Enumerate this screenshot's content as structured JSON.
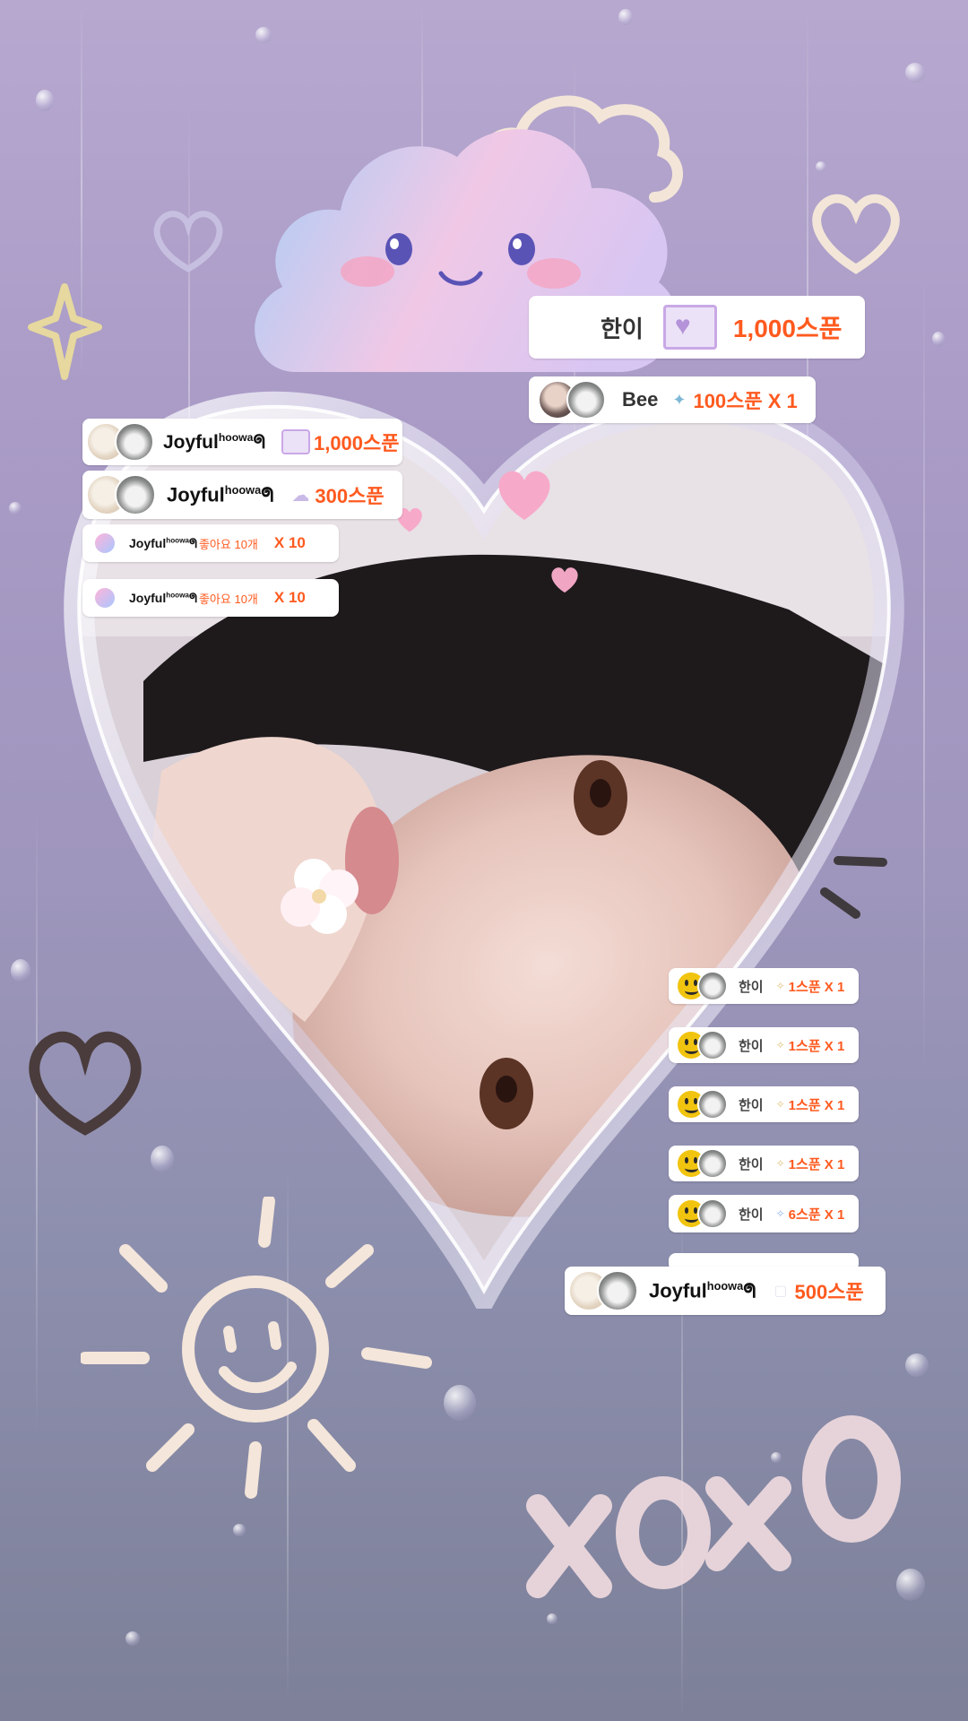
{
  "gifts_top_right": [
    {
      "name": "한이",
      "amount": "1,000스푼"
    },
    {
      "name": "Bee",
      "amount": "100스푼 X 1"
    }
  ],
  "gifts_left": [
    {
      "name": "Joyful",
      "name_sup": "hoowa",
      "name_suffix": "ᖗ",
      "amount": "1,000스푼"
    },
    {
      "name": "Joyful",
      "name_sup": "hoowa",
      "name_suffix": "ᖗ",
      "amount": "300스푼"
    }
  ],
  "likes": [
    {
      "name": "Joyful",
      "name_sup": "hoowa",
      "name_suffix": "ᖗ",
      "label": "좋아요 10개",
      "mult": "X 10"
    },
    {
      "name": "Joyful",
      "name_sup": "hoowa",
      "name_suffix": "ᖗ",
      "label": "좋아요 10개",
      "mult": "X 10"
    }
  ],
  "gifts_bottom_right": [
    {
      "name": "한이",
      "amount": "1스푼 X 1"
    },
    {
      "name": "한이",
      "amount": "1스푼 X 1"
    },
    {
      "name": "한이",
      "amount": "1스푼 X 1"
    },
    {
      "name": "한이",
      "amount": "1스푼 X 1"
    },
    {
      "name": "한이",
      "amount": "6스푼 X 1"
    }
  ],
  "gift_bottom": {
    "name": "Joyful",
    "name_sup": "hoowa",
    "name_suffix": "ᖗ",
    "amount": "500스푼"
  },
  "decor_text": "xoxo",
  "colors": {
    "accent_orange": "#ff5a1f",
    "card_bg": "#ffffff",
    "lilac": "#b6a8cf"
  }
}
